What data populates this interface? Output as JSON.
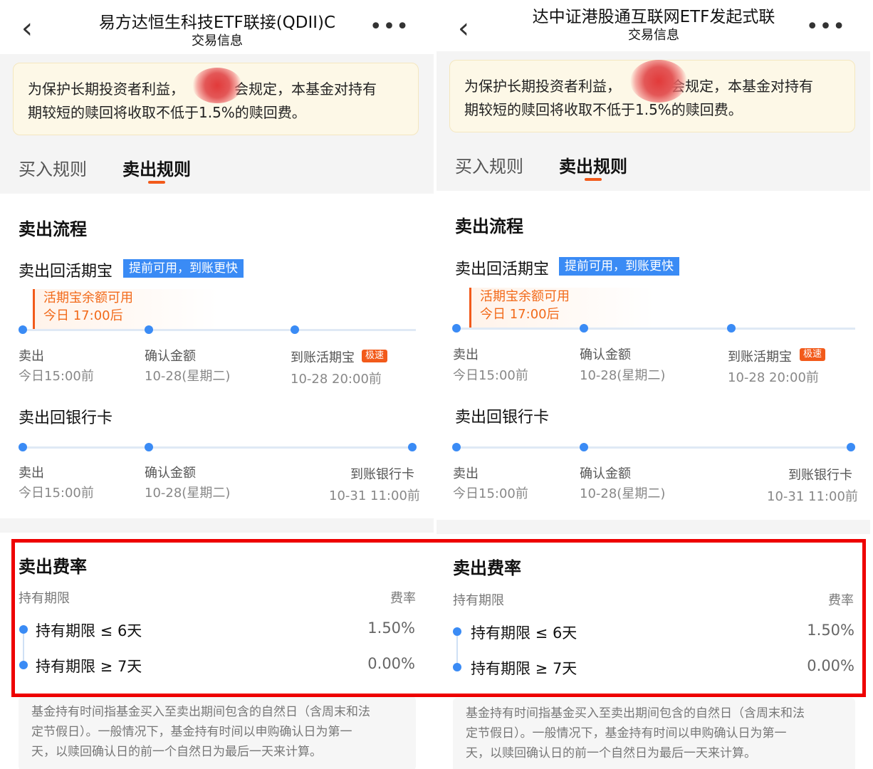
{
  "panels": [
    {
      "nav_title": "易方达恒生科技ETF联接(QDII)C",
      "nav_subtitle": "交易信息",
      "back_icon": "‹",
      "more_icon": "•••",
      "notice": {
        "line1": "为保护长期投资者利益，",
        "line1b": "会规定，本基金对持有",
        "line2": "期较短的赎回将收取不低于1.5%的赎回费。"
      },
      "tabs": {
        "buy": "买入规则",
        "sell": "卖出规则"
      },
      "sell_process": {
        "title": "卖出流程",
        "to_huoqibao": {
          "title": "卖出回活期宝",
          "tag": "提前可用，到账更快",
          "hint_line1": "活期宝余额可用",
          "hint_line2": "今日 17:00后",
          "steps": [
            {
              "label": "卖出",
              "time": "今日15:00前"
            },
            {
              "label": "确认金额",
              "time": "10-28(星期二)"
            },
            {
              "label": "到账活期宝",
              "badge": "极速",
              "time": "10-28 20:00前"
            }
          ]
        },
        "to_bank": {
          "title": "卖出回银行卡",
          "steps": [
            {
              "label": "卖出",
              "time": "今日15:00前"
            },
            {
              "label": "确认金额",
              "time": "10-28(星期二)"
            },
            {
              "label": "到账银行卡",
              "time": "10-31 11:00前"
            }
          ]
        }
      },
      "fees": {
        "title": "卖出费率",
        "col_period": "持有期限",
        "col_rate": "费率",
        "rows": [
          {
            "period": "持有期限 ≤ 6天",
            "rate": "1.50%"
          },
          {
            "period": "持有期限 ≥ 7天",
            "rate": "0.00%"
          }
        ]
      },
      "note": {
        "line1": "基金持有时间指基金买入至卖出期间包含的自然日（含周末和法",
        "line2": "定节假日）。一般情况下，基金持有时间以申购确认日为第一",
        "line3": "天，以赎回确认日的前一个自然日为最后一天来计算。"
      }
    },
    {
      "nav_title": "达中证港股通互联网ETF发起式联",
      "nav_subtitle": "交易信息",
      "back_icon": "‹",
      "more_icon": "•••",
      "notice": {
        "line1": "为保护长期投资者利益，",
        "line1b": "会规定，本基金对持有",
        "line2": "期较短的赎回将收取不低于1.5%的赎回费。"
      },
      "tabs": {
        "buy": "买入规则",
        "sell": "卖出规则"
      },
      "sell_process": {
        "title": "卖出流程",
        "to_huoqibao": {
          "title": "卖出回活期宝",
          "tag": "提前可用，到账更快",
          "hint_line1": "活期宝余额可用",
          "hint_line2": "今日 17:00后",
          "steps": [
            {
              "label": "卖出",
              "time": "今日15:00前"
            },
            {
              "label": "确认金额",
              "time": "10-28(星期二)"
            },
            {
              "label": "到账活期宝",
              "badge": "极速",
              "time": "10-28 20:00前"
            }
          ]
        },
        "to_bank": {
          "title": "卖出回银行卡",
          "steps": [
            {
              "label": "卖出",
              "time": "今日15:00前"
            },
            {
              "label": "确认金额",
              "time": "10-28(星期二)"
            },
            {
              "label": "到账银行卡",
              "time": "10-31 11:00前"
            }
          ]
        }
      },
      "fees": {
        "title": "卖出费率",
        "col_period": "持有期限",
        "col_rate": "费率",
        "rows": [
          {
            "period": "持有期限 ≤ 6天",
            "rate": "1.50%"
          },
          {
            "period": "持有期限 ≥ 7天",
            "rate": "0.00%"
          }
        ]
      },
      "note": {
        "line1": "基金持有时间指基金买入至卖出期间包含的自然日（含周末和法",
        "line2": "定节假日）。一般情况下，基金持有时间以申购确认日为第一",
        "line3": "天，以赎回确认日的前一个自然日为最后一天来计算。"
      }
    }
  ],
  "colors": {
    "accent_blue": "#3a8bf5",
    "accent_orange": "#f25a1a",
    "highlight_red": "#ee0000"
  }
}
